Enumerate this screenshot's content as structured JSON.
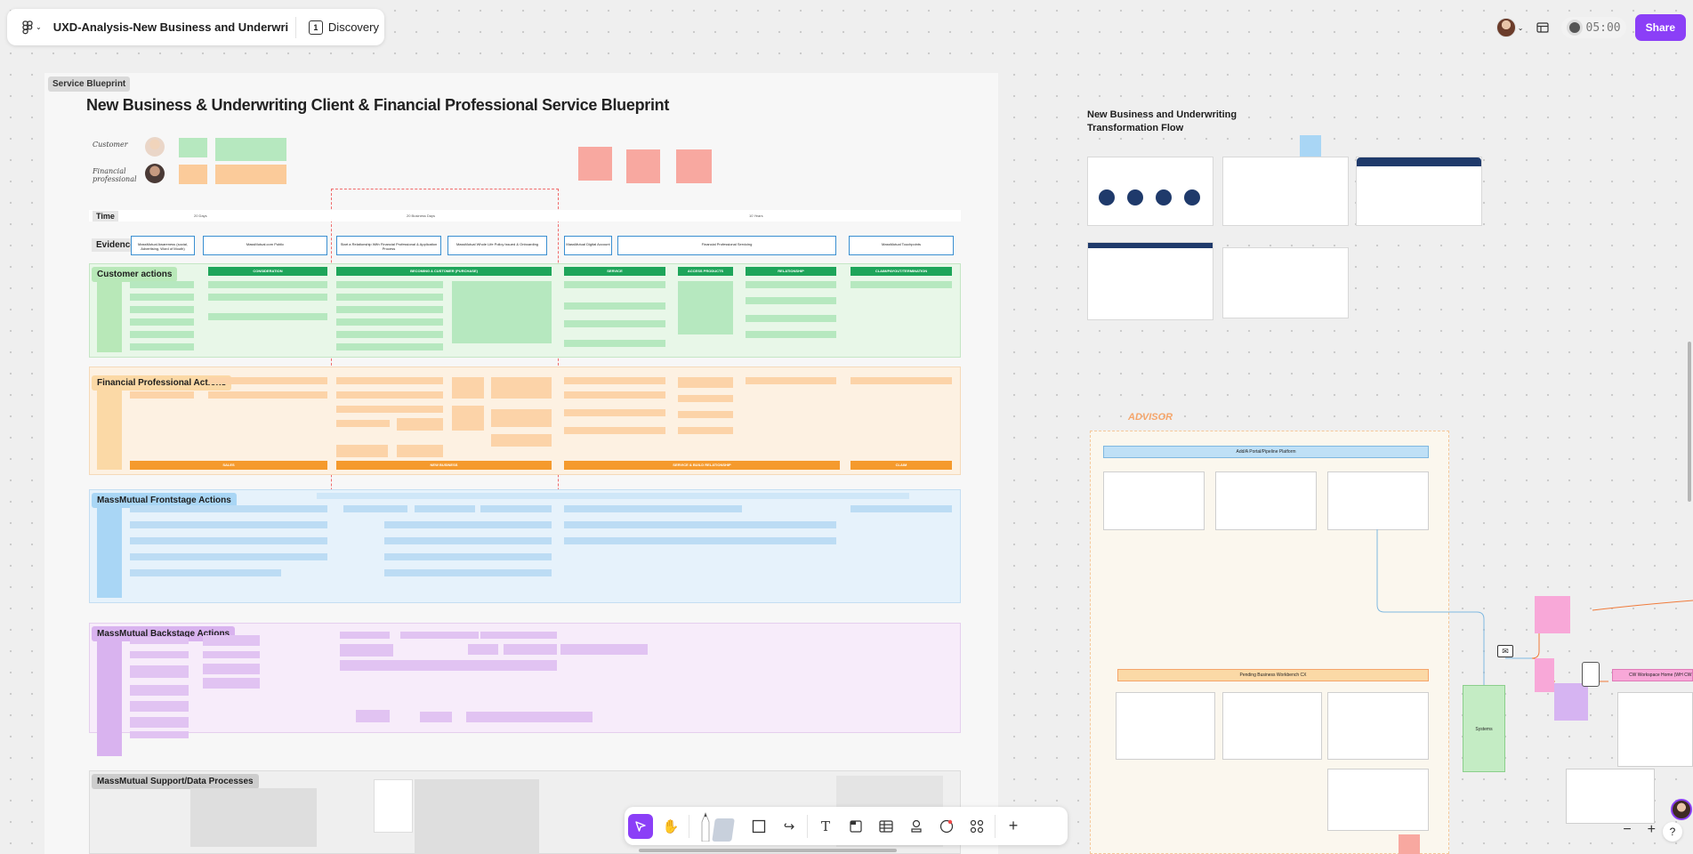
{
  "toolbar_top": {
    "file_title": "UXD-Analysis-New Business and Underwriting ...",
    "page_name": "Discovery",
    "page_number": "1",
    "timer": "05:00",
    "share_label": "Share"
  },
  "board": {
    "tag": "Service Blueprint",
    "title": "New Business & Underwriting Client & Financial Professional Service Blueprint",
    "persona_customer": "Customer",
    "persona_fp": "Financial professional",
    "time_label": "Time",
    "time_segments": [
      "20 Days",
      "20 Business Days",
      "10 Years"
    ],
    "evidence_label": "Evidence",
    "lanes": {
      "customer": "Customer actions",
      "fp": "Financial Professional Actions",
      "frontstage": "MassMutual Frontstage Actions",
      "backstage": "MassMutual Backstage Actions",
      "support": "MassMutual Support/Data Processes"
    },
    "stage_headers": [
      "CONSIDERATION",
      "BECOMING A CUSTOMER (PURCHASE)",
      "SERVICE",
      "ACCESS PRODUCTS",
      "RELATIONSHIP",
      "CLAIM/PAYOUT/TERMINATION"
    ],
    "fp_footer": [
      "SALES",
      "NEW BUSINESS",
      "SERVICE & BUILD RELATIONSHIP",
      "CLAIM"
    ],
    "evidence_boxes": [
      "MassMutual Awareness (social, Advertising, Word of Mouth)",
      "MassMutual.com Public",
      "Start a Relationship With Financial Professional & Application Process",
      "MassMutual Whole Life Policy Issued & Onboarding",
      "MassMutual Digital Account",
      "Financial Professional Servicing",
      "MassMutual Touchpoints"
    ]
  },
  "right": {
    "flow_title": "New Business and Underwriting Transformation Flow",
    "advisor_label": "ADVISOR",
    "platform_bar": "Add/A Portal/Pipeline Platform",
    "pending_bar": "Pending Business Workbench CX",
    "systems_box": "Systems",
    "workspace_bar": "CW Workspace Home (WH CW TC)"
  },
  "colors": {
    "accent": "#8b3ff7",
    "customer_lane": "#e8f7e8",
    "fp_lane": "#fdf1e2",
    "frontstage_lane": "#e6f2fb",
    "backstage_lane": "#f7ecfa",
    "support_lane": "#efefef"
  },
  "icons": [
    "figma-menu-icon",
    "chevron-down-icon",
    "layout-icon",
    "move-tool-icon",
    "hand-tool-icon",
    "pen-tool-icon",
    "shape-tool-icon",
    "connector-tool-icon",
    "text-tool-icon",
    "section-tool-icon",
    "table-tool-icon",
    "stamp-tool-icon",
    "sticker-tool-icon",
    "more-tools-icon",
    "add-icon",
    "zoom-out-icon",
    "zoom-in-icon",
    "help-icon"
  ]
}
